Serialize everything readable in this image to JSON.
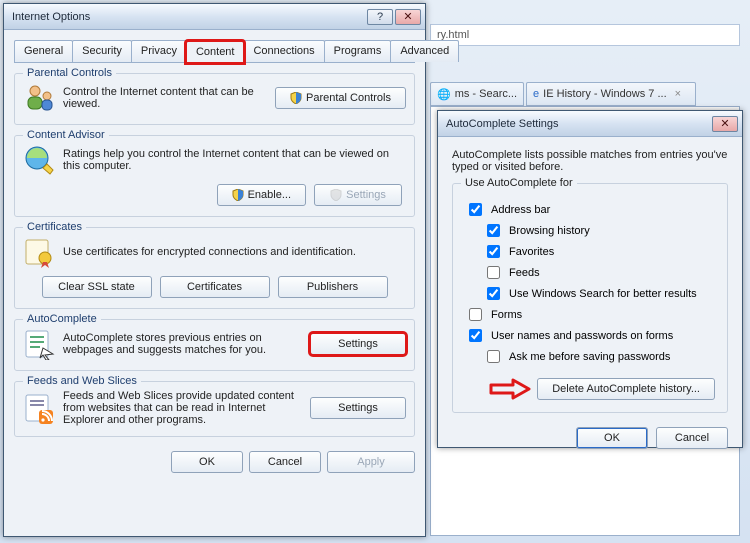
{
  "bg": {
    "url_fragment": "ry.html",
    "tabs": [
      {
        "label": "ms - Searc..."
      },
      {
        "label": "IE History - Windows 7 ..."
      }
    ]
  },
  "io": {
    "title": "Internet Options",
    "tabs": [
      "General",
      "Security",
      "Privacy",
      "Content",
      "Connections",
      "Programs",
      "Advanced"
    ],
    "active_tab": "Content",
    "parental": {
      "legend": "Parental Controls",
      "desc": "Control the Internet content that can be viewed.",
      "button": "Parental Controls"
    },
    "advisor": {
      "legend": "Content Advisor",
      "desc": "Ratings help you control the Internet content that can be viewed on this computer.",
      "enable": "Enable...",
      "settings": "Settings"
    },
    "certs": {
      "legend": "Certificates",
      "desc": "Use certificates for encrypted connections and identification.",
      "clear": "Clear SSL state",
      "certificates": "Certificates",
      "publishers": "Publishers"
    },
    "autocomplete": {
      "legend": "AutoComplete",
      "desc": "AutoComplete stores previous entries on webpages and suggests matches for you.",
      "settings": "Settings"
    },
    "feeds": {
      "legend": "Feeds and Web Slices",
      "desc": "Feeds and Web Slices provide updated content from websites that can be read in Internet Explorer and other programs.",
      "settings": "Settings"
    },
    "footer": {
      "ok": "OK",
      "cancel": "Cancel",
      "apply": "Apply"
    }
  },
  "ac": {
    "title": "AutoComplete Settings",
    "intro": "AutoComplete lists possible matches from entries you've typed or visited before.",
    "group_legend": "Use AutoComplete for",
    "checks": {
      "address_bar": {
        "label": "Address bar",
        "checked": true
      },
      "browsing": {
        "label": "Browsing history",
        "checked": true
      },
      "favorites": {
        "label": "Favorites",
        "checked": true
      },
      "feeds": {
        "label": "Feeds",
        "checked": false
      },
      "winsearch": {
        "label": "Use Windows Search for better results",
        "checked": true
      },
      "forms": {
        "label": "Forms",
        "checked": false
      },
      "userpass": {
        "label": "User names and passwords on forms",
        "checked": true
      },
      "askme": {
        "label": "Ask me before saving passwords",
        "checked": false
      }
    },
    "delete_btn": "Delete AutoComplete history...",
    "ok": "OK",
    "cancel": "Cancel"
  }
}
